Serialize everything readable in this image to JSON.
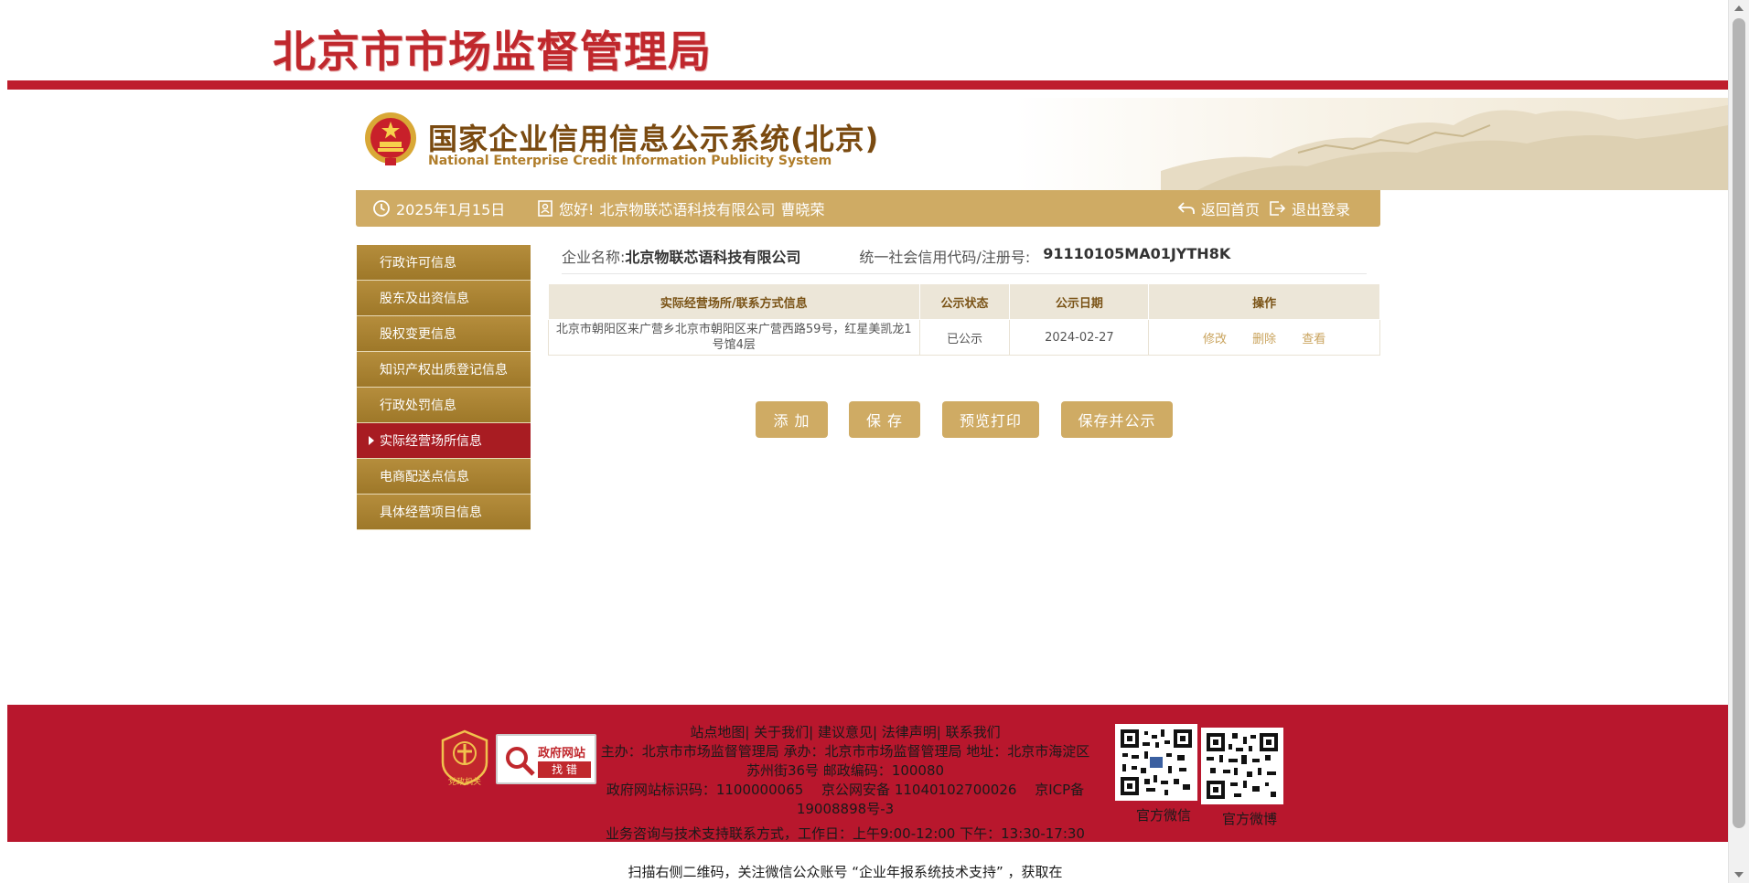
{
  "bureau": {
    "title": "北京市市场监督管理局"
  },
  "system": {
    "title_cn": "国家企业信用信息公示系统(北京)",
    "title_en": "National Enterprise Credit Information Publicity System"
  },
  "info_bar": {
    "date": "2025年1月15日",
    "greeting": "您好!",
    "company": "北京物联芯语科技有限公司",
    "user": "曹晓荣",
    "home": "返回首页",
    "logout": "退出登录"
  },
  "nav": {
    "items": [
      {
        "label": "行政许可信息"
      },
      {
        "label": "股东及出资信息"
      },
      {
        "label": "股权变更信息"
      },
      {
        "label": "知识产权出质登记信息"
      },
      {
        "label": "行政处罚信息"
      },
      {
        "label": "实际经营场所信息"
      },
      {
        "label": "电商配送点信息"
      },
      {
        "label": "具体经营项目信息"
      }
    ],
    "active_index": 5
  },
  "company": {
    "name_label": "企业名称:",
    "name": "北京物联芯语科技有限公司",
    "code_label": "统一社会信用代码/注册号:",
    "code": "91110105MA01JYTH8K"
  },
  "table": {
    "headers": [
      "实际经营场所/联系方式信息",
      "公示状态",
      "公示日期",
      "操作"
    ],
    "rows": [
      {
        "address": "北京市朝阳区来广营乡北京市朝阳区来广营西路59号，红星美凯龙1号馆4层",
        "status": "已公示",
        "date": "2024-02-27",
        "ops": [
          "修改",
          "删除",
          "查看"
        ]
      }
    ]
  },
  "buttons": {
    "add": "添 加",
    "save": "保 存",
    "preview": "预览打印",
    "save_publish": "保存并公示"
  },
  "footer": {
    "links": "站点地图| 关于我们| 建议意见| 法律声明| 联系我们",
    "line1": "主办：北京市市场监督管理局 承办：北京市市场监督管理局 地址：北京市海淀区苏州街36号 邮政编码：100080",
    "line2": "政府网站标识码：1100000065 　京公网安备 11040102700026 　京ICP备19008898号-3",
    "line3": "业务咨询与技术支持联系方式，工作日：上午9:00-12:00 下午：13:30-17:30",
    "line4": "扫描右侧二维码，关注微信公众账号 “企业年报系统技术支持” ，获取在",
    "badge1": "党政机关",
    "badge2_top": "政府网站",
    "badge2_bottom": "找 错",
    "wechat_label": "官方微信",
    "weibo_label": "官方微博"
  },
  "colors": {
    "bureau_red": "#be1e2d",
    "gold": "#cfab64",
    "nav_gold": "#a88433",
    "nav_active": "#a81c22",
    "footer_red": "#b8172d"
  }
}
